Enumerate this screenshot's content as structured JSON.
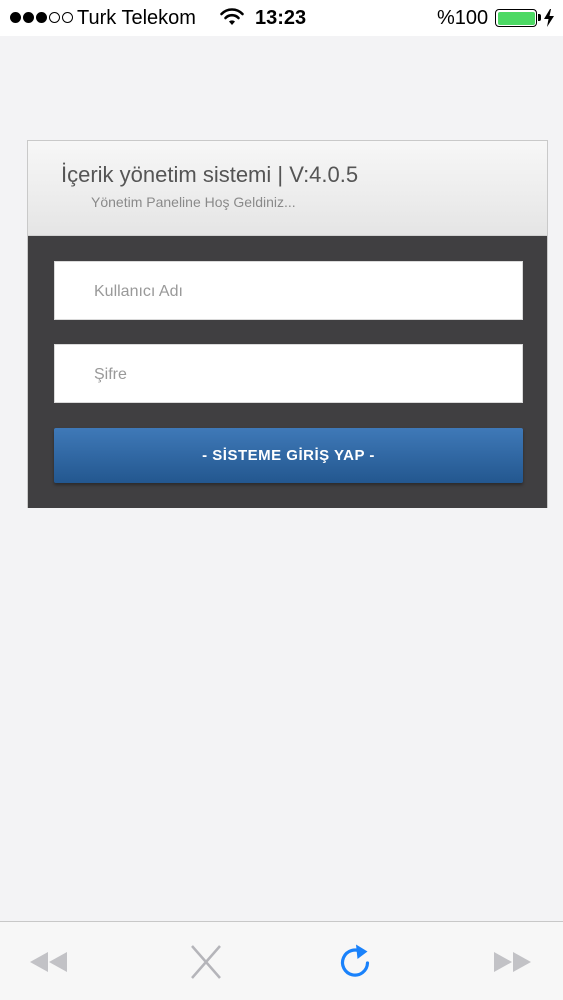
{
  "status_bar": {
    "signal_bars_filled": 3,
    "signal_bars_total": 5,
    "carrier": "Turk Telekom",
    "time": "13:23",
    "battery_percent": "%100",
    "battery_level": 1.0,
    "battery_color": "#4cd964",
    "icons": [
      "wifi-icon",
      "battery-icon",
      "charging-bolt-icon"
    ]
  },
  "login": {
    "title": "İçerik yönetim sistemi | V:4.0.5",
    "subtitle": "Yönetim Paneline Hoş Geldiniz...",
    "username_placeholder": "Kullanıcı Adı",
    "password_placeholder": "Şifre",
    "submit_label": "- SİSTEME GİRİŞ YAP -",
    "colors": {
      "panel_background": "#403f41",
      "button": "#2d66a4"
    }
  },
  "toolbar": {
    "items": [
      "back-icon",
      "stop-icon",
      "reload-icon",
      "forward-icon"
    ],
    "accent": "#1a82fb"
  }
}
